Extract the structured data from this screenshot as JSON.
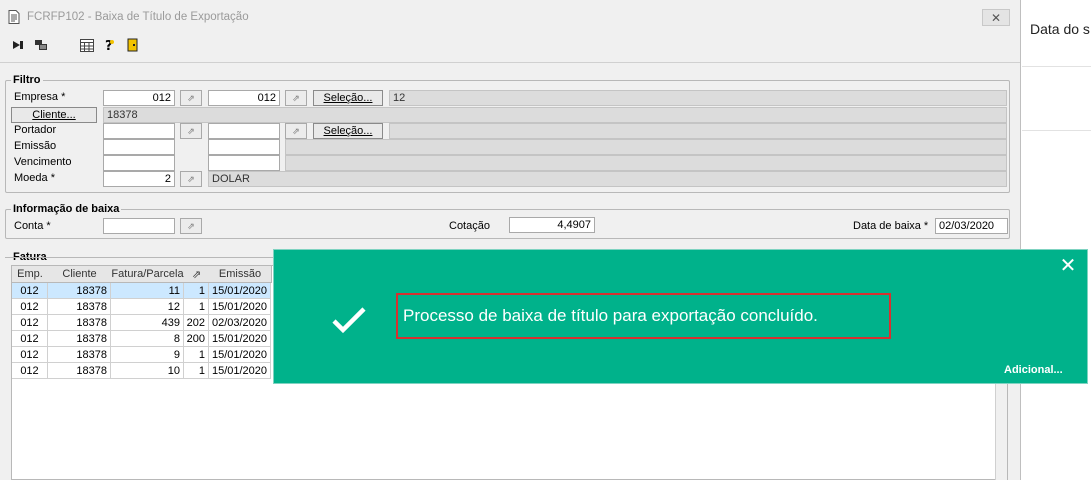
{
  "window": {
    "title": "FCRFP102 - Baixa de Título de Exportação",
    "close_label": "✕"
  },
  "filtro": {
    "group_label": "Filtro",
    "empresa_label": "Empresa *",
    "empresa_from": "012",
    "empresa_to": "012",
    "empresa_selecao": "Seleção...",
    "empresa_desc": "12",
    "cliente_button": "Cliente...",
    "cliente_value": "18378",
    "portador_label": "Portador",
    "portador_selecao": "Seleção...",
    "emissao_label": "Emissão",
    "vencimento_label": "Vencimento",
    "moeda_label": "Moeda *",
    "moeda_value": "2",
    "moeda_desc": "DOLAR"
  },
  "baixa": {
    "group_label": "Informação de baixa",
    "conta_label": "Conta *",
    "cotacao_label": "Cotação",
    "cotacao_value": "4,4907",
    "data_label": "Data de baixa *",
    "data_value": "02/03/2020"
  },
  "fatura": {
    "group_label": "Fatura",
    "columns": [
      "Emp.",
      "Cliente",
      "Fatura/Parcela",
      "",
      "Emissão"
    ],
    "rows": [
      [
        "012",
        "18378",
        "11",
        "1",
        "15/01/2020"
      ],
      [
        "012",
        "18378",
        "12",
        "1",
        "15/01/2020"
      ],
      [
        "012",
        "18378",
        "439",
        "202",
        "02/03/2020"
      ],
      [
        "012",
        "18378",
        "8",
        "200",
        "15/01/2020"
      ],
      [
        "012",
        "18378",
        "9",
        "1",
        "15/01/2020"
      ],
      [
        "012",
        "18378",
        "10",
        "1",
        "15/01/2020"
      ]
    ]
  },
  "right_panel": {
    "title": "Data do s"
  },
  "toast": {
    "message": "Processo de baixa de título para exportação concluído.",
    "more_link": "Adicional...",
    "close": "✕",
    "color": "#00b28b"
  }
}
